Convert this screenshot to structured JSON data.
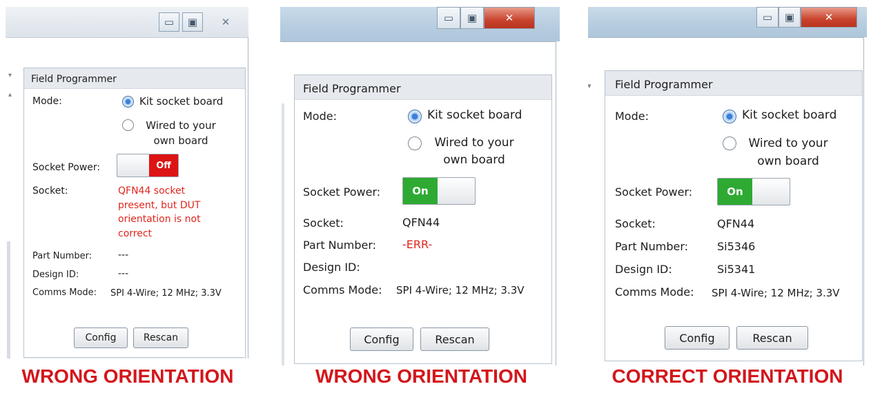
{
  "panels": [
    {
      "caption": "WRONG ORIENTATION",
      "window_controls": {
        "minimize": "▭",
        "maximize": "▣",
        "close": "✕"
      },
      "title": "Field Programmer",
      "mode_label": "Mode:",
      "mode_options": [
        "Kit socket board",
        "Wired to your own board"
      ],
      "mode_selected": "Kit socket board",
      "socket_power_label": "Socket Power:",
      "socket_power": "Off",
      "socket_label": "Socket:",
      "socket_value": "QFN44 socket present, but DUT orientation is not correct",
      "part_number_label": "Part Number:",
      "part_number": "---",
      "design_id_label": "Design ID:",
      "design_id": "---",
      "comms_mode_label": "Comms Mode:",
      "comms_mode": "SPI 4-Wire; 12 MHz; 3.3V",
      "buttons": [
        "Config",
        "Rescan"
      ]
    },
    {
      "caption": "WRONG ORIENTATION",
      "window_controls": {
        "minimize": "▭",
        "maximize": "▣",
        "close": "✕"
      },
      "title": "Field Programmer",
      "mode_label": "Mode:",
      "mode_options": [
        "Kit socket board",
        "Wired to your own board"
      ],
      "mode_selected": "Kit socket board",
      "socket_power_label": "Socket Power:",
      "socket_power": "On",
      "socket_label": "Socket:",
      "socket_value": "QFN44",
      "part_number_label": "Part Number:",
      "part_number": "-ERR-",
      "design_id_label": "Design ID:",
      "design_id": "",
      "comms_mode_label": "Comms Mode:",
      "comms_mode": "SPI 4-Wire; 12 MHz; 3.3V",
      "buttons": [
        "Config",
        "Rescan"
      ]
    },
    {
      "caption": "CORRECT ORIENTATION",
      "window_controls": {
        "minimize": "▭",
        "maximize": "▣",
        "close": "✕"
      },
      "title": "Field Programmer",
      "mode_label": "Mode:",
      "mode_options": [
        "Kit socket board",
        "Wired to your own board"
      ],
      "mode_selected": "Kit socket board",
      "socket_power_label": "Socket Power:",
      "socket_power": "On",
      "socket_label": "Socket:",
      "socket_value": "QFN44",
      "part_number_label": "Part Number:",
      "part_number": "Si5346",
      "design_id_label": "Design ID:",
      "design_id": "Si5341",
      "comms_mode_label": "Comms Mode:",
      "comms_mode": "SPI 4-Wire; 12 MHz; 3.3V",
      "buttons": [
        "Config",
        "Rescan"
      ]
    }
  ],
  "colors": {
    "error_text": "#e0251d",
    "toggle_on": "#2eaa33",
    "toggle_off": "#dd1414",
    "caption": "#d3161c"
  },
  "icons": [
    "minimize-icon",
    "maximize-icon",
    "close-icon",
    "radio-selected-icon",
    "radio-unselected-icon",
    "scroll-arrow-icon"
  ]
}
